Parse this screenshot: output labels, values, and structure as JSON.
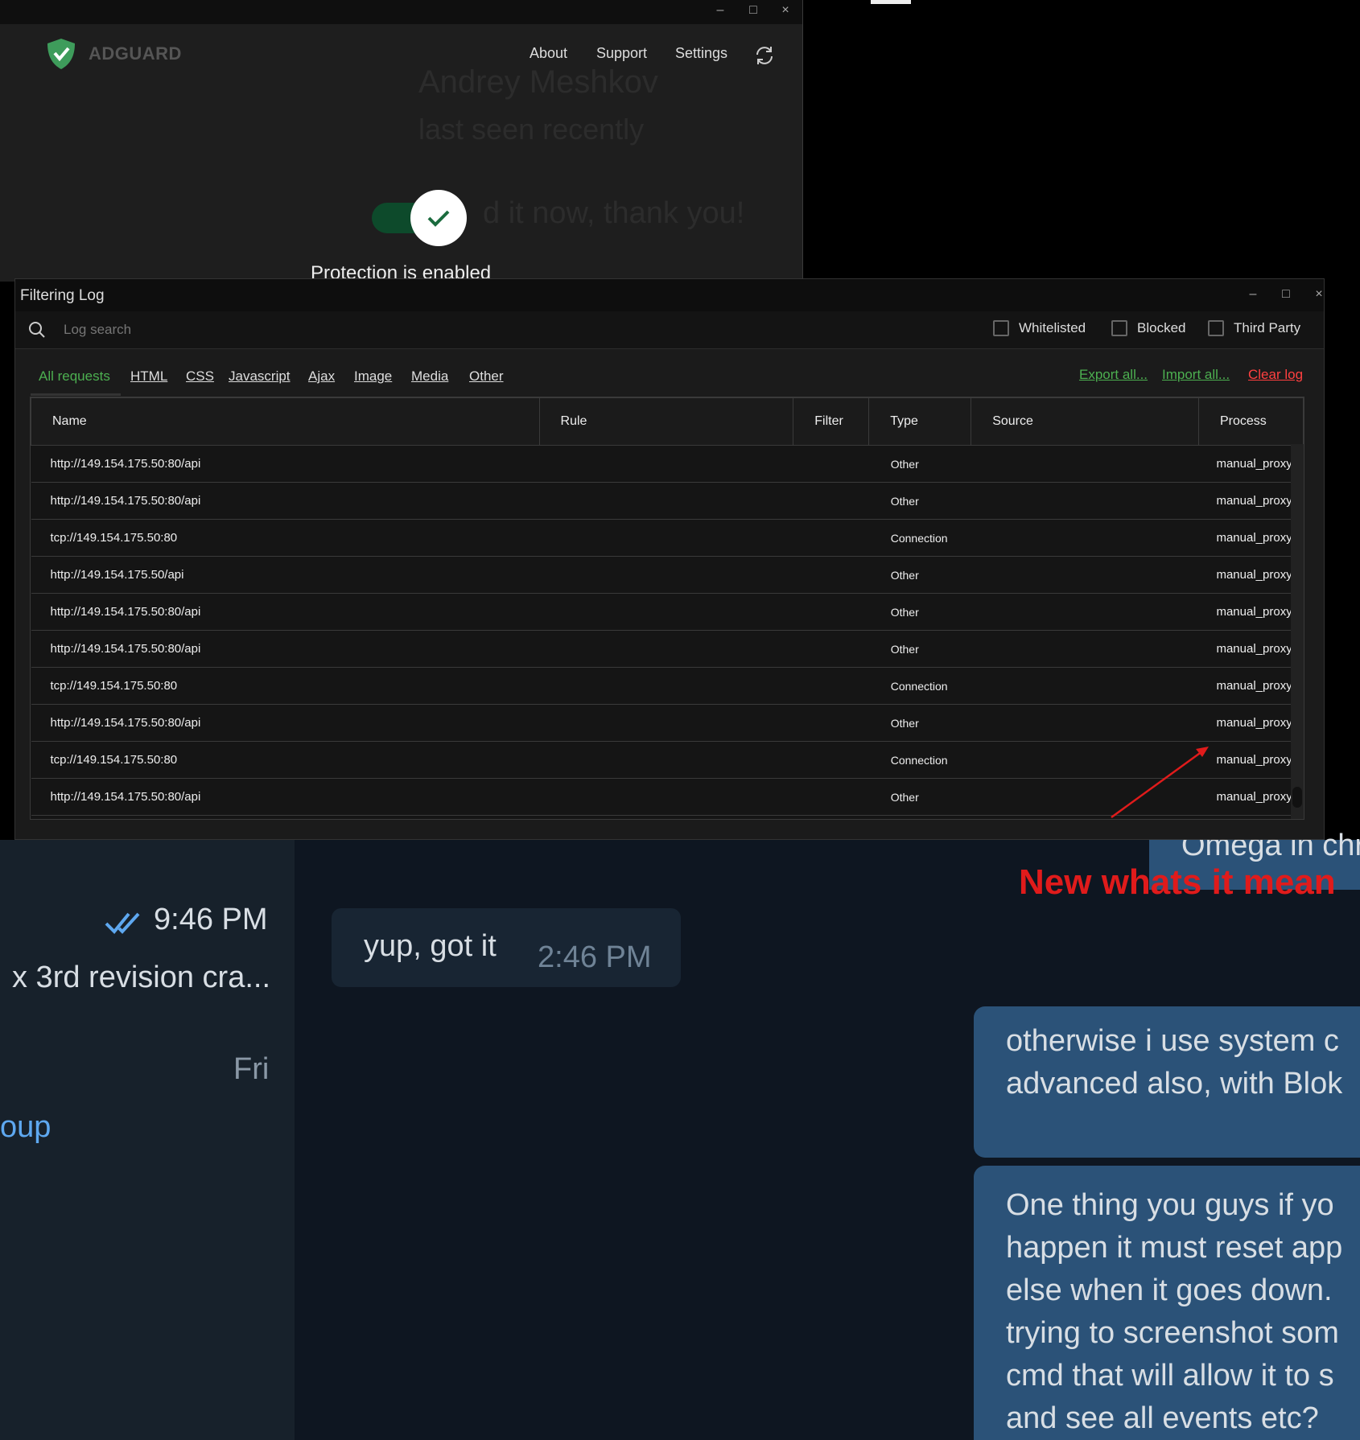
{
  "adguard": {
    "brand": "ADGUARD",
    "nav": [
      "About",
      "Support",
      "Settings"
    ],
    "protection_status": "Protection is enabled",
    "ghost_name": "Andrey Meshkov",
    "ghost_status": "last seen recently",
    "ghost_msg": "d it now, thank you!"
  },
  "filtering_log": {
    "title": "Filtering Log",
    "search_placeholder": "Log search",
    "filters": [
      "Whitelisted",
      "Blocked",
      "Third Party"
    ],
    "tabs": [
      "All requests",
      "HTML",
      "CSS",
      "Javascript",
      "Ajax",
      "Image",
      "Media",
      "Other"
    ],
    "actions": {
      "export": "Export all...",
      "import": "Import all...",
      "clear": "Clear log"
    },
    "columns": [
      "Name",
      "Rule",
      "Filter",
      "Type",
      "Source",
      "Process"
    ],
    "rows": [
      {
        "name": "http://149.154.175.50:80/api",
        "type": "Other",
        "process": "manual_proxy"
      },
      {
        "name": "http://149.154.175.50:80/api",
        "type": "Other",
        "process": "manual_proxy"
      },
      {
        "name": "tcp://149.154.175.50:80",
        "type": "Connection",
        "process": "manual_proxy"
      },
      {
        "name": "http://149.154.175.50/api",
        "type": "Other",
        "process": "manual_proxy"
      },
      {
        "name": "http://149.154.175.50:80/api",
        "type": "Other",
        "process": "manual_proxy"
      },
      {
        "name": "http://149.154.175.50:80/api",
        "type": "Other",
        "process": "manual_proxy"
      },
      {
        "name": "tcp://149.154.175.50:80",
        "type": "Connection",
        "process": "manual_proxy"
      },
      {
        "name": "http://149.154.175.50:80/api",
        "type": "Other",
        "process": "manual_proxy"
      },
      {
        "name": "tcp://149.154.175.50:80",
        "type": "Connection",
        "process": "manual_proxy"
      },
      {
        "name": "http://149.154.175.50:80/api",
        "type": "Other",
        "process": "manual_proxy"
      }
    ]
  },
  "telegram": {
    "sidebar": {
      "time": "9:46 PM",
      "preview": "x 3rd revision cra...",
      "day": "Fri",
      "link": "oup"
    },
    "incoming": {
      "text": "yup, got it",
      "time": "2:46 PM"
    },
    "outgoing_top": "Omega in chr",
    "outgoing1": [
      "otherwise i use system c",
      "advanced also, with Blok"
    ],
    "outgoing2": [
      "One thing you guys if yo",
      "happen it must reset app",
      "else when it goes down.",
      "trying to screenshot som",
      "cmd that will allow it to s",
      "and see all events etc?"
    ]
  },
  "annotation": "New whats it mean",
  "colors": {
    "accent_green": "#4caf50",
    "clear_red": "#ff4040",
    "annotation_red": "#e01b1b",
    "tg_bubble_out": "#2b5278"
  }
}
